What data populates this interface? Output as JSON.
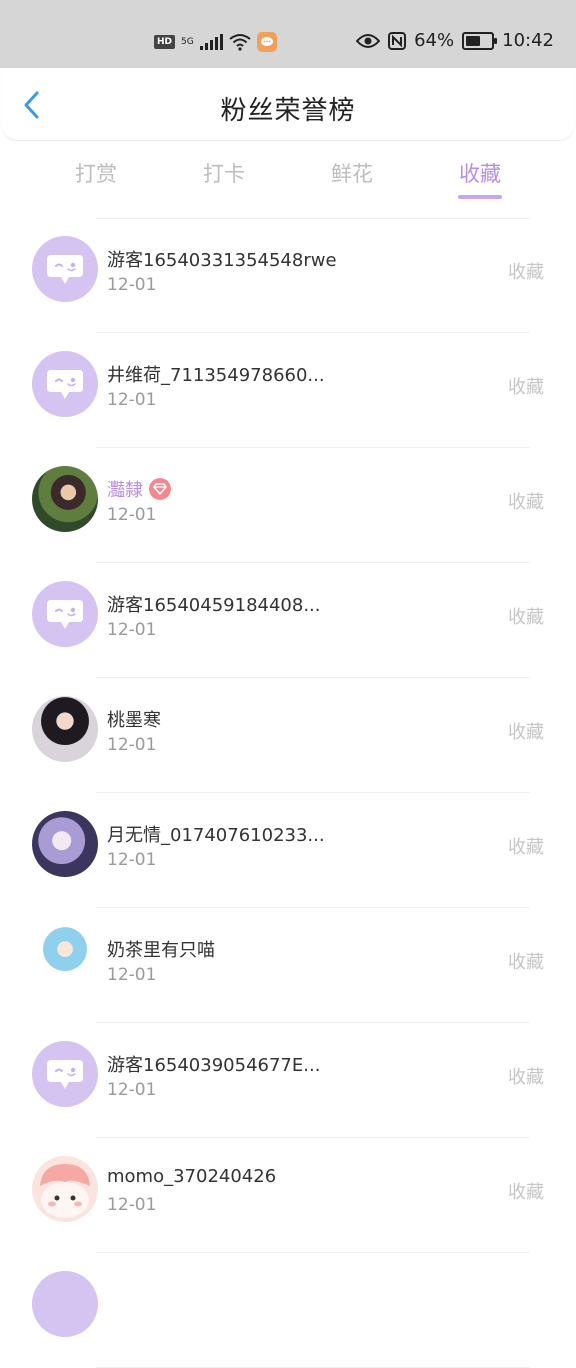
{
  "status_bar": {
    "hd": "HD",
    "network": "5G",
    "battery_percent": "64%",
    "battery_level": 0.64,
    "time": "10:42",
    "icons": [
      "hd-icon",
      "signal-icon",
      "wifi-icon",
      "message-app-icon",
      "eye-icon",
      "nfc-icon",
      "battery-icon"
    ]
  },
  "header": {
    "title": "粉丝荣誉榜",
    "back_icon": "back-chevron-icon"
  },
  "tabs": [
    {
      "label": "打赏"
    },
    {
      "label": "打卡"
    },
    {
      "label": "鲜花"
    },
    {
      "label": "收藏"
    }
  ],
  "active_tab": 3,
  "colors": {
    "accent": "#b98ee6",
    "tab_underline": "#c8a6ee",
    "avatar_placeholder": "#d5c3f2",
    "gem": "#f3898f"
  },
  "list": [
    {
      "name": "游客16540331354548rwe",
      "date": "12-01",
      "action": "收藏",
      "avatar": "placeholder"
    },
    {
      "name": "井维荷_711354978660...",
      "date": "12-01",
      "action": "收藏",
      "avatar": "placeholder"
    },
    {
      "name": "灩隸",
      "date": "12-01",
      "action": "收藏",
      "avatar": "photo",
      "vip": true
    },
    {
      "name": "游客16540459184408...",
      "date": "12-01",
      "action": "收藏",
      "avatar": "placeholder"
    },
    {
      "name": "桃墨寒",
      "date": "12-01",
      "action": "收藏",
      "avatar": "photo"
    },
    {
      "name": "月无情_017407610233...",
      "date": "12-01",
      "action": "收藏",
      "avatar": "photo"
    },
    {
      "name": "奶茶里有只喵",
      "date": "12-01",
      "action": "收藏",
      "avatar": "photo"
    },
    {
      "name": "游客1654039054677E...",
      "date": "12-01",
      "action": "收藏",
      "avatar": "placeholder"
    },
    {
      "name": "momo_370240426",
      "date": "12-01",
      "action": "收藏",
      "avatar": "photo"
    }
  ]
}
